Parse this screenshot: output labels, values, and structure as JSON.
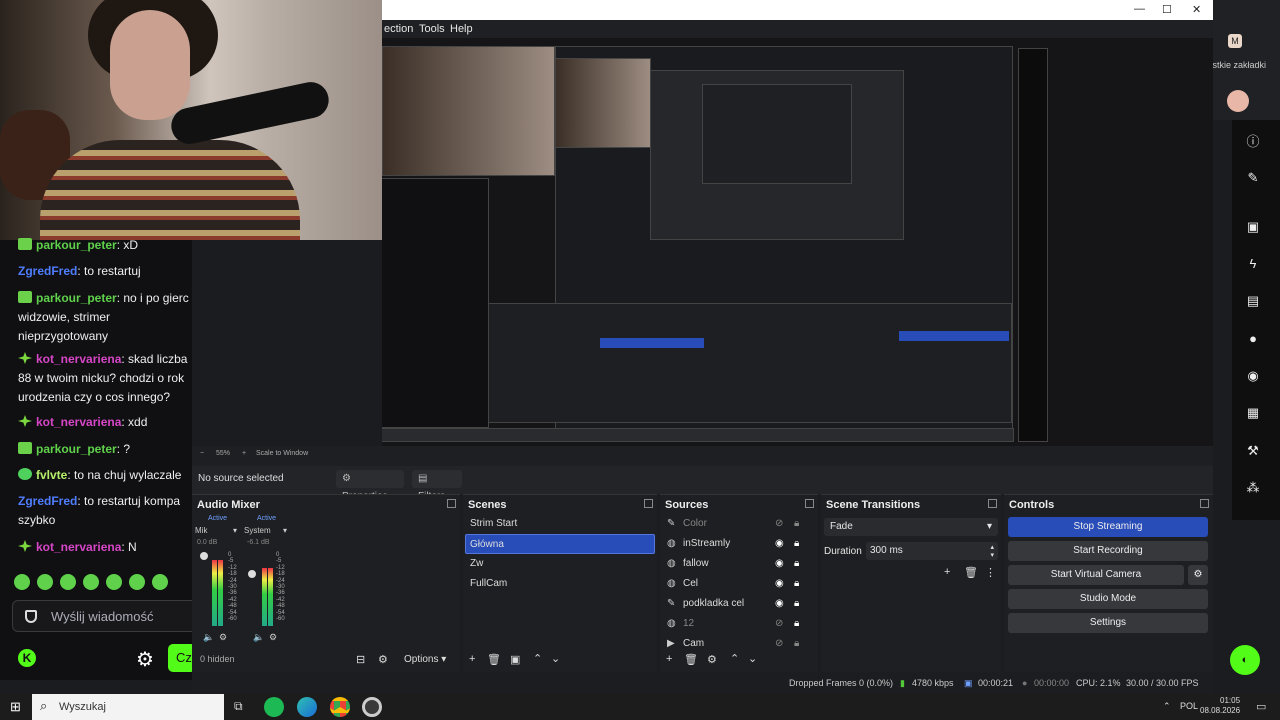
{
  "chat": {
    "messages": [
      {
        "user": "parkour_peter",
        "text": ": xD",
        "color": "#5fd14b",
        "badge": "sub"
      },
      {
        "user": "ZgredFred",
        "text": ": to restartuj",
        "color": "#4f7dff",
        "badge": ""
      },
      {
        "user": "parkour_peter",
        "text": ": no i po gierc widzowie, strimer nieprzygotowany",
        "color": "#5fd14b",
        "badge": "sub"
      },
      {
        "user": "kot_nervariena",
        "text": ": skad liczba 88 w twoim nicku? chodzi o rok urodzenia czy o cos innego?",
        "color": "#d646c6",
        "badge": "og"
      },
      {
        "user": "kot_nervariena",
        "text": ": xdd",
        "color": "#d646c6",
        "badge": "og"
      },
      {
        "user": "parkour_peter",
        "text": ": ?",
        "color": "#5fd14b",
        "badge": "sub"
      },
      {
        "user": "fvlvte",
        "text": ": to na chuj wylaczale",
        "color": "#b6f06b",
        "badge": "vip"
      },
      {
        "user": "ZgredFred",
        "text": ": to restartuj kompa szybko",
        "color": "#4f7dff",
        "badge": ""
      },
      {
        "user": "kot_nervariena",
        "text": ": N",
        "color": "#d646c6",
        "badge": "og"
      }
    ],
    "input_placeholder": "Wyślij wiadomość",
    "send_label": "Cz",
    "kick_logo": "K"
  },
  "browser": {
    "bookmarks": "ystkie zakładki"
  },
  "obs": {
    "menu": [
      "ection",
      "Tools",
      "Help"
    ],
    "title_controls": [
      "—",
      "☐",
      "✕"
    ],
    "zoom": "55%",
    "scale_mode": "Scale to Window",
    "no_source": "No source selected",
    "properties_label": "Properties",
    "filters_label": "Filters",
    "audio_mixer": {
      "title": "Audio Mixer",
      "channels": [
        {
          "name": "Mik",
          "status": "Active",
          "db": "0.0 dB"
        },
        {
          "name": "System",
          "status": "Active",
          "db": "-6.1 dB"
        }
      ],
      "scale": [
        "0",
        "-5",
        "-12",
        "-18",
        "-24",
        "-30",
        "-36",
        "-42",
        "-48",
        "-54",
        "-60"
      ],
      "hidden": "0 hidden",
      "options": "Options"
    },
    "scenes": {
      "title": "Scenes",
      "items": [
        "Strim Start",
        "Główna",
        "Zw",
        "FullCam"
      ],
      "selected": 1
    },
    "sources": {
      "title": "Sources",
      "items": [
        {
          "name": "Color",
          "icon": "brush-icon",
          "dim": true
        },
        {
          "name": "inStreamly",
          "icon": "globe-icon",
          "dim": false
        },
        {
          "name": "fallow",
          "icon": "globe-icon",
          "dim": false
        },
        {
          "name": "Cel",
          "icon": "globe-icon",
          "dim": false
        },
        {
          "name": "podkladka cel",
          "icon": "brush-icon",
          "dim": false
        },
        {
          "name": "12",
          "icon": "globe-icon",
          "dim": true
        },
        {
          "name": "Cam",
          "icon": "camera-icon",
          "dim": false
        }
      ]
    },
    "transitions": {
      "title": "Scene Transitions",
      "selected": "Fade",
      "duration_label": "Duration",
      "duration_value": "300 ms"
    },
    "controls": {
      "title": "Controls",
      "stop_streaming": "Stop Streaming",
      "start_recording": "Start Recording",
      "start_virtual_camera": "Start Virtual Camera",
      "studio_mode": "Studio Mode",
      "settings": "Settings"
    },
    "status": {
      "dropped": "Dropped Frames 0 (0.0%)",
      "kbps": "4780 kbps",
      "stream_time": "00:00:21",
      "rec_time": "00:00:00",
      "cpu": "CPU: 2.1%",
      "fps": "30.00 / 30.00 FPS"
    }
  },
  "taskbar": {
    "search_placeholder": "Wyszukaj",
    "lang": "POL",
    "time": "01:05",
    "date": "08.08.2026"
  },
  "colors": {
    "accent": "#284cb8",
    "kick_green": "#53fc18"
  }
}
